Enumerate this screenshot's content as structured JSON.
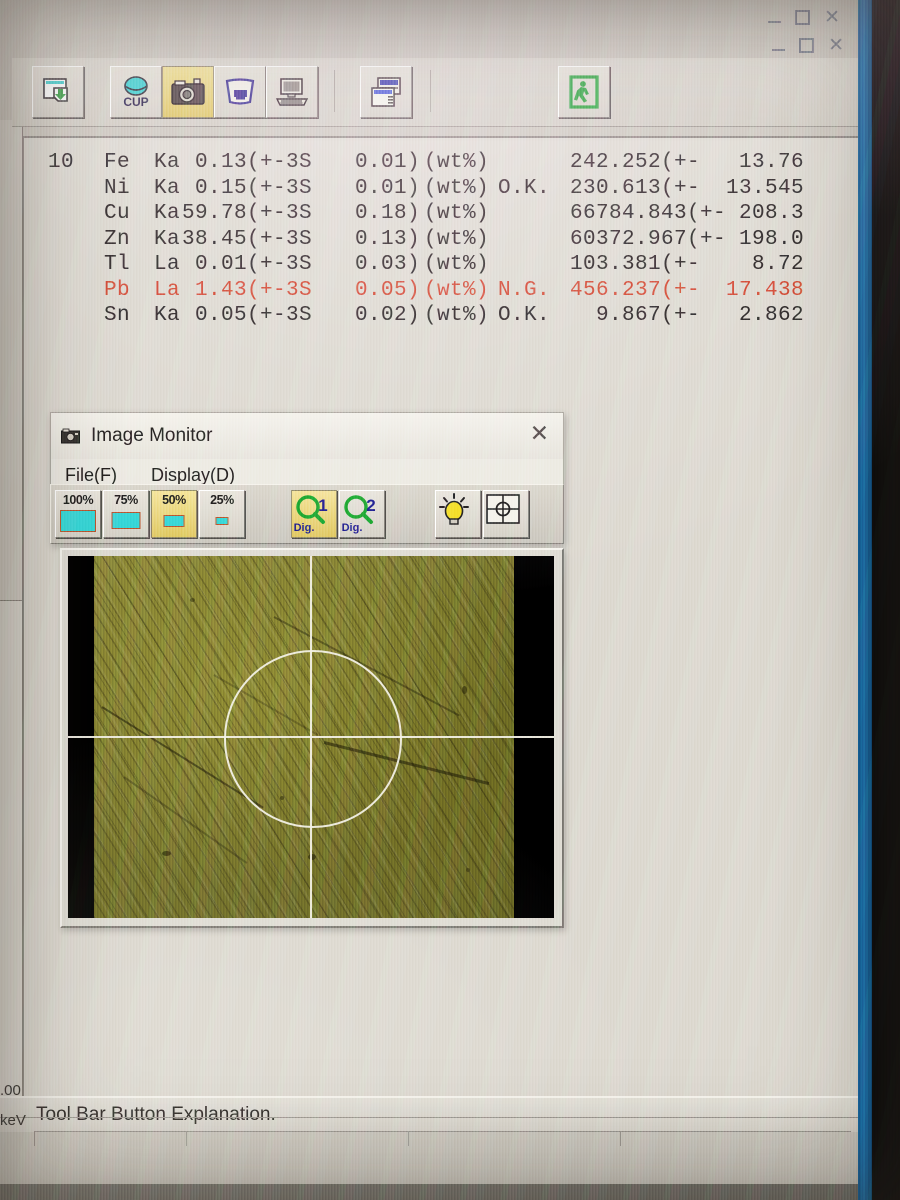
{
  "app": {
    "window_controls": {
      "minimize": "minimize-icon",
      "maximize": "maximize-icon",
      "close": "close-icon"
    }
  },
  "toolbar": {
    "buttons": [
      {
        "name": "save-document-button",
        "icon": "document-save-icon",
        "active": false
      },
      {
        "name": "cup-button",
        "icon": "cup-icon",
        "label": "CUP",
        "active": false
      },
      {
        "name": "camera-button",
        "icon": "camera-icon",
        "active": true
      },
      {
        "name": "sample-holder-button",
        "icon": "sample-holder-icon",
        "active": false
      },
      {
        "name": "computer-button",
        "icon": "computer-icon",
        "active": false
      },
      {
        "name": "window-list-button",
        "icon": "window-list-icon",
        "active": false
      },
      {
        "name": "exit-button",
        "icon": "exit-door-icon",
        "active": false
      }
    ]
  },
  "analysis": {
    "columns": [
      "index",
      "element",
      "line",
      "value",
      "sigma",
      "error",
      "unit",
      "status",
      "intensity",
      "intensity_error"
    ],
    "rows": [
      {
        "index": "10",
        "element": "Fe",
        "line": "Ka",
        "value": "0.13(+-3S",
        "error": "0.01)",
        "unit": "(wt%)",
        "status": "",
        "intensity": "242.252(+-",
        "intensity_error": "13.76",
        "ng": false
      },
      {
        "index": "",
        "element": "Ni",
        "line": "Ka",
        "value": "0.15(+-3S",
        "error": "0.01)",
        "unit": "(wt%)",
        "status": "O.K.",
        "intensity": "230.613(+-",
        "intensity_error": "13.545",
        "ng": false
      },
      {
        "index": "",
        "element": "Cu",
        "line": "Ka",
        "value": "59.78(+-3S",
        "error": "0.18)",
        "unit": "(wt%)",
        "status": "",
        "intensity": "66784.843(+-",
        "intensity_error": "208.3",
        "ng": false
      },
      {
        "index": "",
        "element": "Zn",
        "line": "Ka",
        "value": "38.45(+-3S",
        "error": "0.13)",
        "unit": "(wt%)",
        "status": "",
        "intensity": "60372.967(+-",
        "intensity_error": "198.0",
        "ng": false
      },
      {
        "index": "",
        "element": "Tl",
        "line": "La",
        "value": "0.01(+-3S",
        "error": "0.03)",
        "unit": "(wt%)",
        "status": "",
        "intensity": "103.381(+-",
        "intensity_error": "8.72",
        "ng": false
      },
      {
        "index": "",
        "element": "Pb",
        "line": "La",
        "value": "1.43(+-3S",
        "error": "0.05)",
        "unit": "(wt%)",
        "status": "N.G.",
        "intensity": "456.237(+-",
        "intensity_error": "17.438",
        "ng": true
      },
      {
        "index": "",
        "element": "Sn",
        "line": "Ka",
        "value": "0.05(+-3S",
        "error": "0.02)",
        "unit": "(wt%)",
        "status": "O.K.",
        "intensity": "9.867(+-",
        "intensity_error": "2.862",
        "ng": false
      }
    ]
  },
  "background_panel": {
    "value_label": ".00",
    "unit_label": "keV"
  },
  "image_monitor": {
    "title": "Image Monitor",
    "title_icon": "camera-window-icon",
    "close_label": "✕",
    "menu": [
      {
        "name": "menu-file",
        "label": "File(F)"
      },
      {
        "name": "menu-display",
        "label": "Display(D)"
      }
    ],
    "zoom_buttons": [
      {
        "name": "zoom-100-button",
        "label": "100%",
        "active": false
      },
      {
        "name": "zoom-75-button",
        "label": "75%",
        "active": false
      },
      {
        "name": "zoom-50-button",
        "label": "50%",
        "active": true
      },
      {
        "name": "zoom-25-button",
        "label": "25%",
        "active": false
      }
    ],
    "tool_buttons": [
      {
        "name": "digital-zoom-1-button",
        "icon": "magnifier-1-icon",
        "label": "Dig.",
        "number": "1",
        "active": true
      },
      {
        "name": "digital-zoom-2-button",
        "icon": "magnifier-2-icon",
        "label": "Dig.",
        "number": "2",
        "active": false
      },
      {
        "name": "lamp-button",
        "icon": "light-bulb-icon",
        "active": false
      },
      {
        "name": "crosshair-button",
        "icon": "crosshair-target-icon",
        "active": false
      }
    ],
    "image": {
      "name": "sample-camera-view",
      "description": "brass sample surface with crosshair and measurement circle overlay"
    }
  },
  "statusbar": {
    "message": "Tool Bar Button Explanation."
  },
  "colors": {
    "ng_red": "#d1442b",
    "active_yellow": "#e0c860",
    "face": "#dcd8cf",
    "accent_cyan": "#34d6d6"
  }
}
